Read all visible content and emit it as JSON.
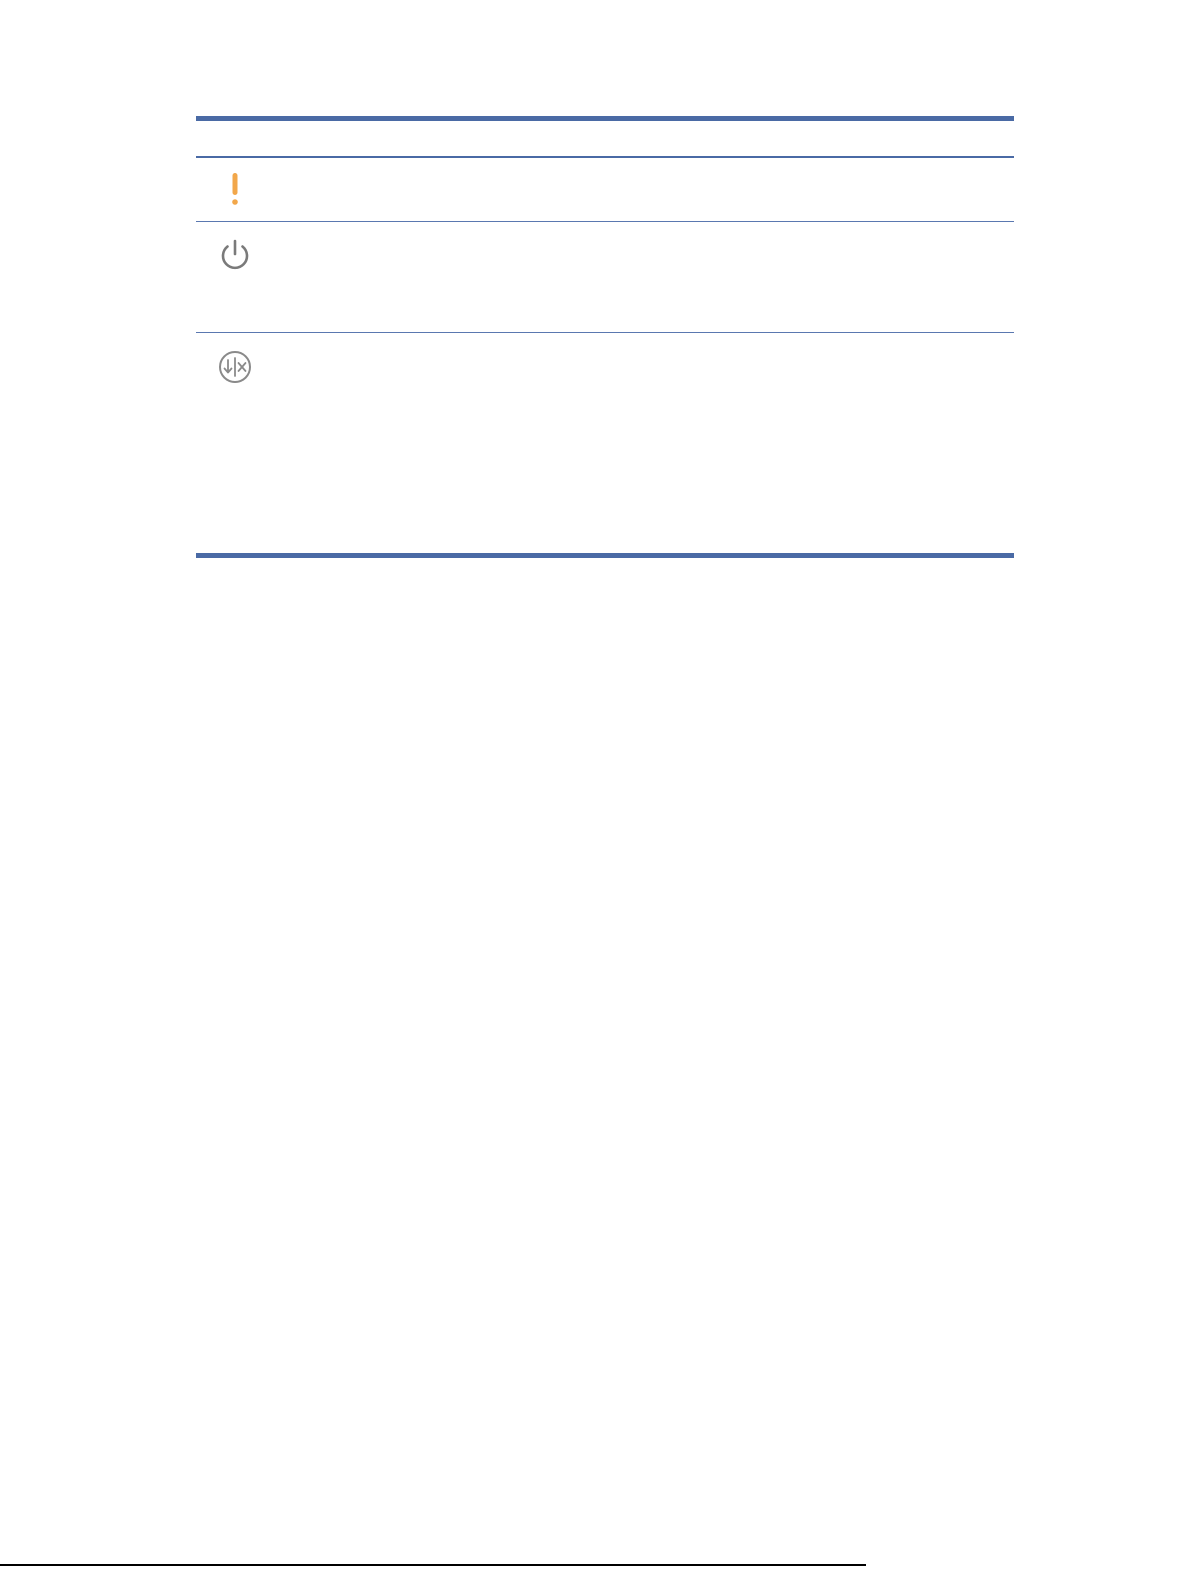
{
  "table": {
    "rows": [
      {
        "icon": "exclamation-icon",
        "icon_color": "#f2a74a"
      },
      {
        "icon": "power-icon",
        "icon_color": "#7a7a7a"
      },
      {
        "icon": "scan-cancel-icon",
        "icon_color": "#7a7a7a"
      }
    ],
    "rule_color": "#4a6aa5"
  }
}
